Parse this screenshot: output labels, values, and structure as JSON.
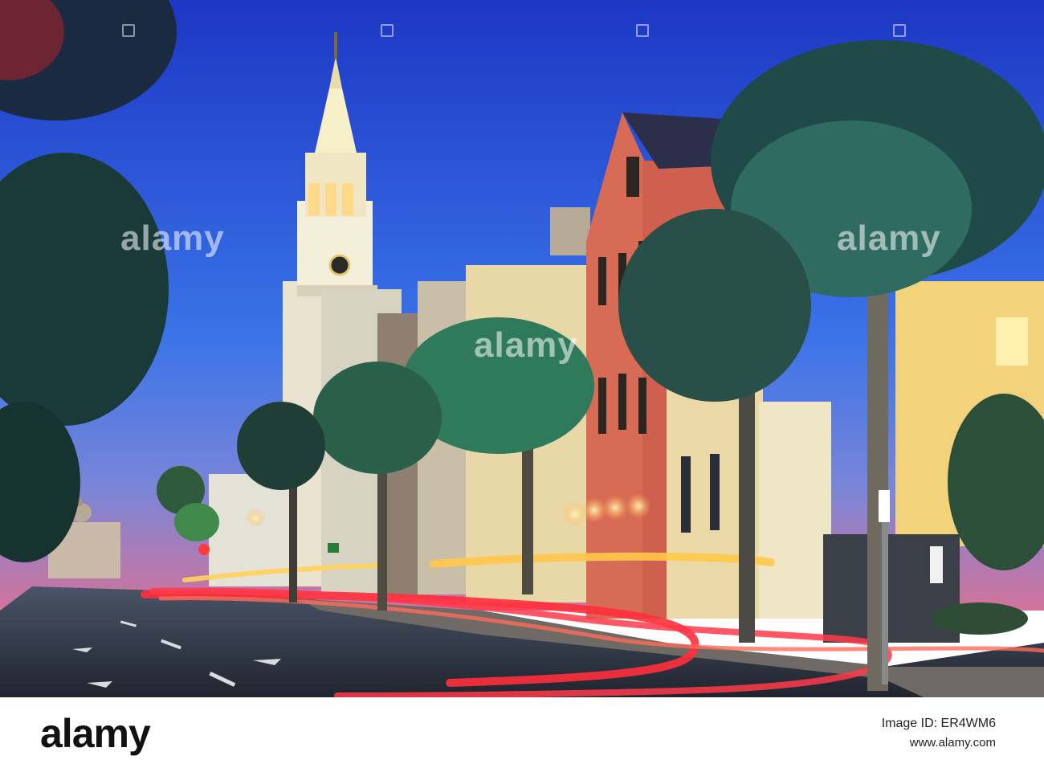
{
  "watermark": {
    "text": "alamy",
    "color": "#ffffff"
  },
  "footer": {
    "logo": "alamy",
    "image_id_line": "Image ID: ER4WM6",
    "url_line": "www.alamy.com"
  },
  "palette": {
    "sky_top": "#1f3fc9",
    "sky_horizon": "#c06a90",
    "steeple": "#f3efd6",
    "red_house": "#d96a55",
    "light_trail": "#ff2f3c",
    "road": "#2e3540"
  }
}
